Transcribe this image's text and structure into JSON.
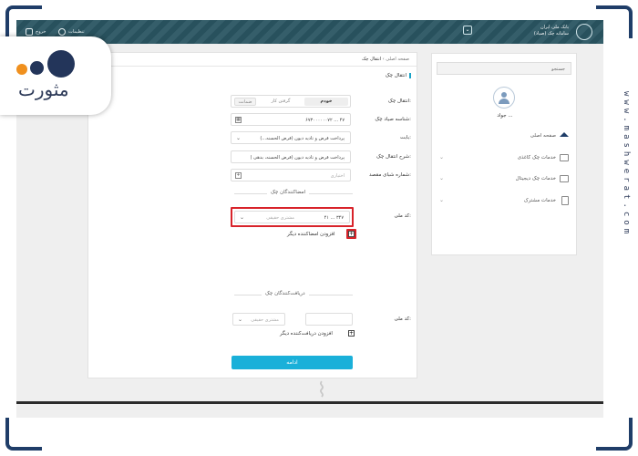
{
  "topbar": {
    "bank_line1": "بانک ملی ایران",
    "bank_line2": "سامانه چک (صیاد)",
    "settings": "تنظیمات",
    "exit": "خروج"
  },
  "breadcrumb": {
    "home": "صفحه اصلی",
    "sep": "›",
    "current": "انتقال چک"
  },
  "form": {
    "section_title": "انتقال چک",
    "transfer_label": "انتقال چک:",
    "toggle_self": "خودم",
    "toggle_guarantee": "گرفتن کار",
    "toggle_other": "ضمانت",
    "sayad_label": "شناسه صیاد چک:",
    "sayad_value": "۶۷۳۰۰۰۰۰۰۷۲ ... ۴۷",
    "reason_label": "بابت:",
    "reason_value": "پرداخت قرض و تادیه دیون (قرض الحسنه...)",
    "desc_label": "شرح انتقال چک:",
    "desc_value": "پرداخت قرض و تادیه دیون (قرض الحسنه، بدهی )",
    "account_label": "شماره شبای مقصد:",
    "account_placeholder": "اختیاری",
    "signers_title": "امضاکنندگان چک",
    "signer_id_label": "کد ملی:",
    "signer_id_value": "۴۱ ... ۳۴۷",
    "signer_type": "مشتری حقیقی",
    "add_signer": "افزودن امضاکننده دیگر",
    "receivers_title": "دریافت‌کنندگان چک",
    "receiver_id_label": "کد ملی:",
    "receiver_type": "مشتری حقیقی",
    "add_receiver": "افزودن دریافت‌کننده دیگر",
    "continue_button": "ادامه"
  },
  "sidebar": {
    "search_placeholder": "جستجو",
    "user_name": "جواد ...",
    "items": [
      {
        "label": "صفحه اصلی"
      },
      {
        "label": "خدمات چک کاغذی"
      },
      {
        "label": "خدمات چک دیجیتال"
      },
      {
        "label": "خدمات مشترک"
      }
    ]
  },
  "brand": {
    "logo_text": "مثورت",
    "website": "www.mashwerat.com"
  },
  "colors": {
    "topbar": "#2a5562",
    "accent": "#1ab0d9",
    "highlight": "#d8232a",
    "brand_navy": "#1f3d68"
  }
}
